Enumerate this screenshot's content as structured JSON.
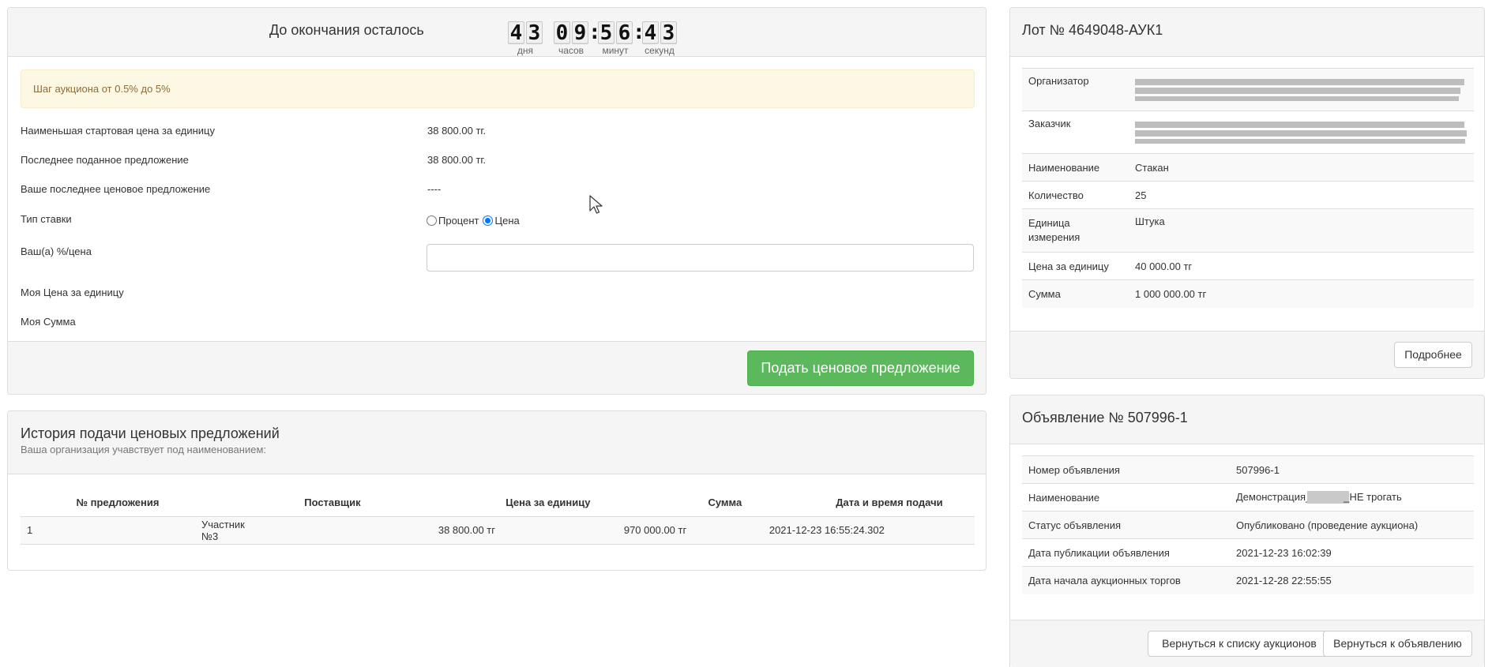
{
  "countdown": {
    "label": "До окончания осталось",
    "days": [
      "4",
      "3"
    ],
    "hours": [
      "0",
      "9"
    ],
    "minutes": [
      "5",
      "6"
    ],
    "seconds": [
      "4",
      "3"
    ],
    "separator": ":",
    "units": {
      "days": "дня",
      "hours": "часов",
      "minutes": "минут",
      "seconds": "секунд"
    }
  },
  "bid": {
    "alert": "Шаг аукциона от 0.5% до 5%",
    "lowest_start_price_label": "Наименьшая стартовая цена за единицу",
    "lowest_start_price_value": "38 800.00 тг.",
    "last_offer_label": "Последнее поданное предложение",
    "last_offer_value": "38 800.00 тг.",
    "your_last_offer_label": "Ваше последнее ценовое предложение",
    "your_last_offer_value": "----",
    "bet_type_label": "Тип ставки",
    "option_percent": "Процент",
    "option_price": "Цена",
    "selected_option": "Цена",
    "your_value_label": "Ваш(а) %/цена",
    "your_value": "",
    "my_unit_price_label": "Моя Цена за единицу",
    "my_sum_label": "Моя Сумма",
    "submit_label": "Подать ценовое предложение"
  },
  "history": {
    "title": "История подачи ценовых предложений",
    "subtitle": "Ваша организация учавствует под наименованием:",
    "columns": [
      "№ предложения",
      "Поставщик",
      "Цена за единицу",
      "Сумма",
      "Дата и время подачи"
    ],
    "rows": [
      [
        "1",
        "Участник №3",
        "38 800.00 тг",
        "970 000.00 тг",
        "2021-12-23 16:55:24.302"
      ]
    ]
  },
  "lot": {
    "title": "Лот № 4649048-АУК1",
    "rows": [
      {
        "label": "Организатор",
        "value": ""
      },
      {
        "label": "Заказчик",
        "value": ""
      },
      {
        "label": "Наименование",
        "value": "Стакан"
      },
      {
        "label": "Количество",
        "value": "25"
      },
      {
        "label": "Единица измерения",
        "value": "Штука"
      },
      {
        "label": "Цена за единицу",
        "value": "40 000.00 тг"
      },
      {
        "label": "Сумма",
        "value": "1 000 000.00 тг"
      }
    ],
    "details_button": "Подробнее"
  },
  "announcement": {
    "title": "Объявление № 507996-1",
    "rows": [
      {
        "label": "Номер объявления",
        "value": "507996-1"
      },
      {
        "label": "Наименование",
        "value_prefix": "Демонстрация_",
        "value_suffix": "_НЕ трогать"
      },
      {
        "label": "Статус объявления",
        "value": "Опубликовано (проведение аукциона)"
      },
      {
        "label": "Дата публикации объявления",
        "value": "2021-12-23 16:02:39"
      },
      {
        "label": "Дата начала аукционных торгов",
        "value": "2021-12-28 22:55:55"
      }
    ],
    "back_to_list_button": "Вернуться к списку аукционов",
    "back_to_announcement_button": "Вернуться к объявлению"
  },
  "colors": {
    "success": "#5cb85c",
    "warning_bg": "#fcf8e3",
    "warning_text": "#8a6d3b",
    "panel_heading_bg": "#f5f5f5",
    "border": "#dddddd"
  }
}
